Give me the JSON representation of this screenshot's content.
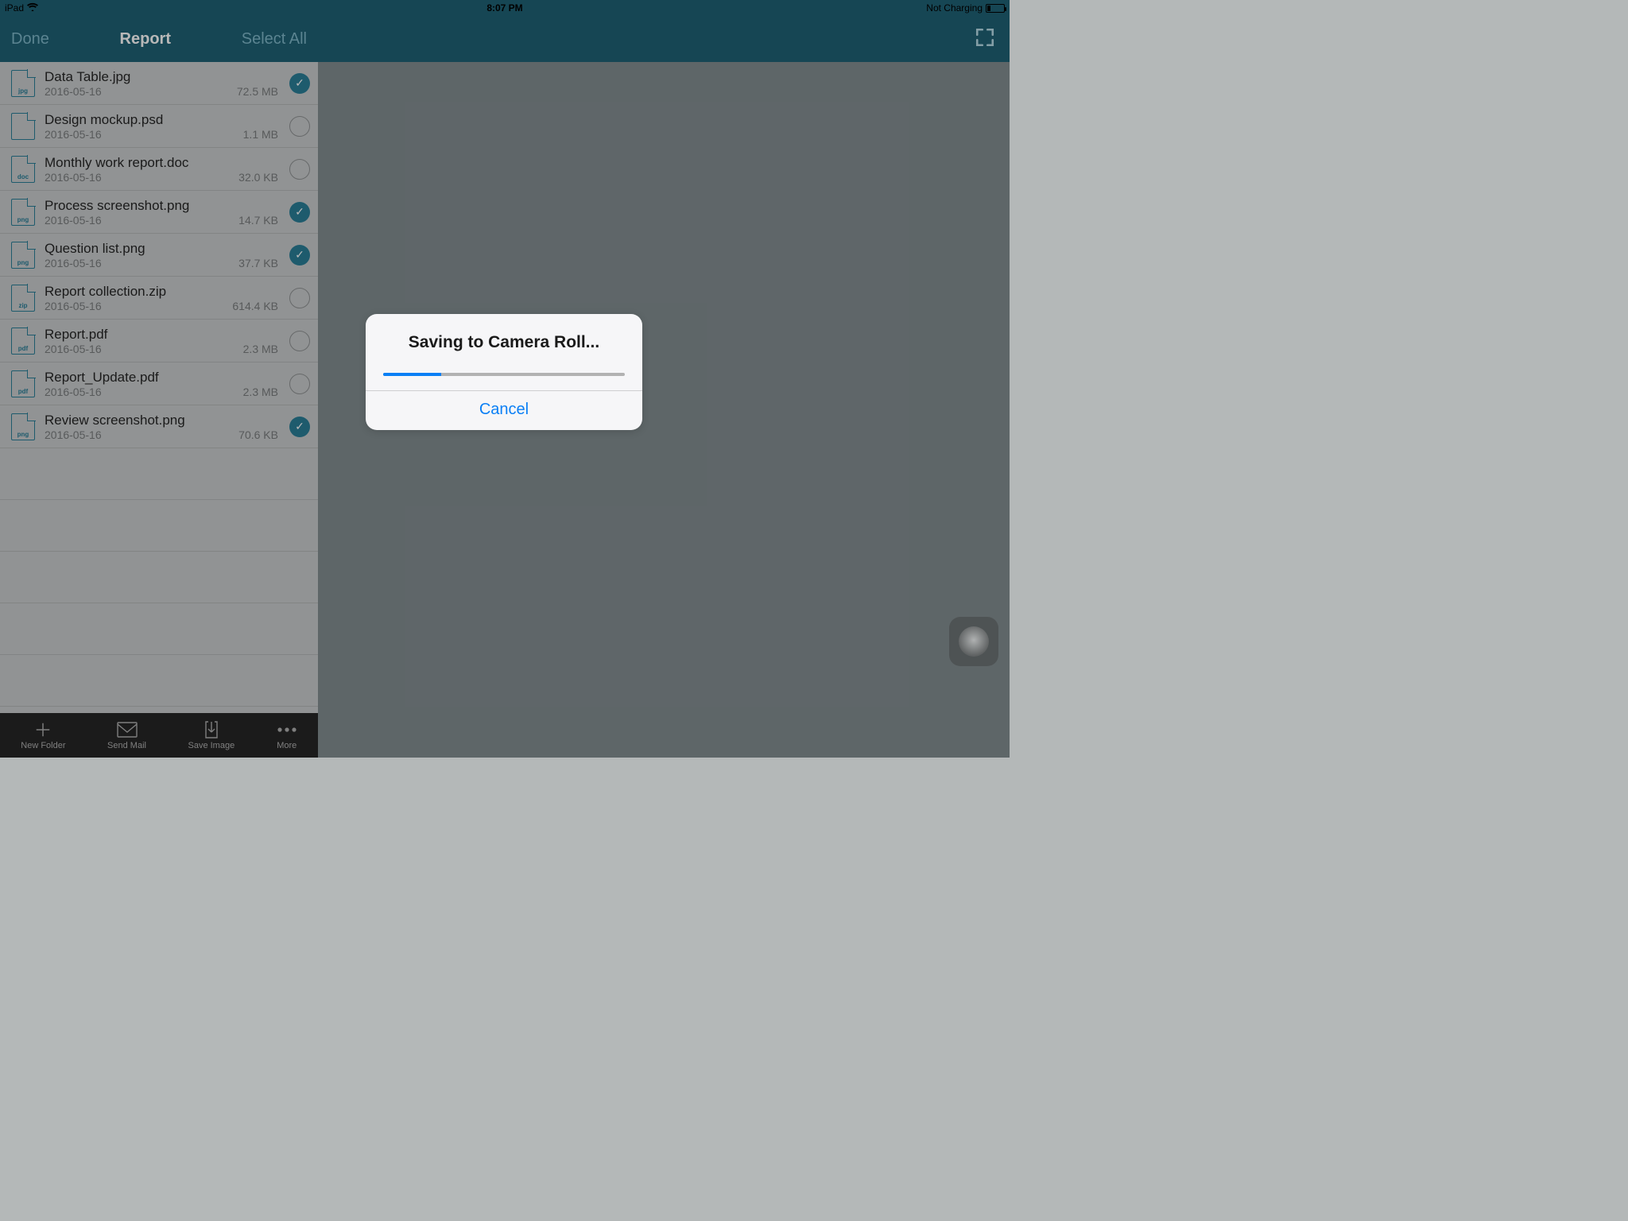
{
  "statusbar": {
    "device": "iPad",
    "time": "8:07 PM",
    "charging": "Not Charging"
  },
  "navbar": {
    "done": "Done",
    "title": "Report",
    "select_all": "Select All"
  },
  "files": [
    {
      "ext": "jpg",
      "name": "Data Table.jpg",
      "date": "2016-05-16",
      "size": "72.5 MB",
      "selected": true
    },
    {
      "ext": "",
      "name": "Design mockup.psd",
      "date": "2016-05-16",
      "size": "1.1 MB",
      "selected": false
    },
    {
      "ext": "doc",
      "name": "Monthly work report.doc",
      "date": "2016-05-16",
      "size": "32.0 KB",
      "selected": false
    },
    {
      "ext": "png",
      "name": "Process screenshot.png",
      "date": "2016-05-16",
      "size": "14.7 KB",
      "selected": true
    },
    {
      "ext": "png",
      "name": "Question list.png",
      "date": "2016-05-16",
      "size": "37.7 KB",
      "selected": true
    },
    {
      "ext": "zip",
      "name": "Report collection.zip",
      "date": "2016-05-16",
      "size": "614.4 KB",
      "selected": false
    },
    {
      "ext": "pdf",
      "name": "Report.pdf",
      "date": "2016-05-16",
      "size": "2.3 MB",
      "selected": false
    },
    {
      "ext": "pdf",
      "name": "Report_Update.pdf",
      "date": "2016-05-16",
      "size": "2.3 MB",
      "selected": false
    },
    {
      "ext": "png",
      "name": "Review screenshot.png",
      "date": "2016-05-16",
      "size": "70.6 KB",
      "selected": true
    }
  ],
  "toolbar": {
    "new_folder": "New Folder",
    "send_mail": "Send Mail",
    "save_image": "Save Image",
    "more": "More"
  },
  "dialog": {
    "title": "Saving to Camera Roll...",
    "cancel": "Cancel",
    "progress_percent": 24
  }
}
